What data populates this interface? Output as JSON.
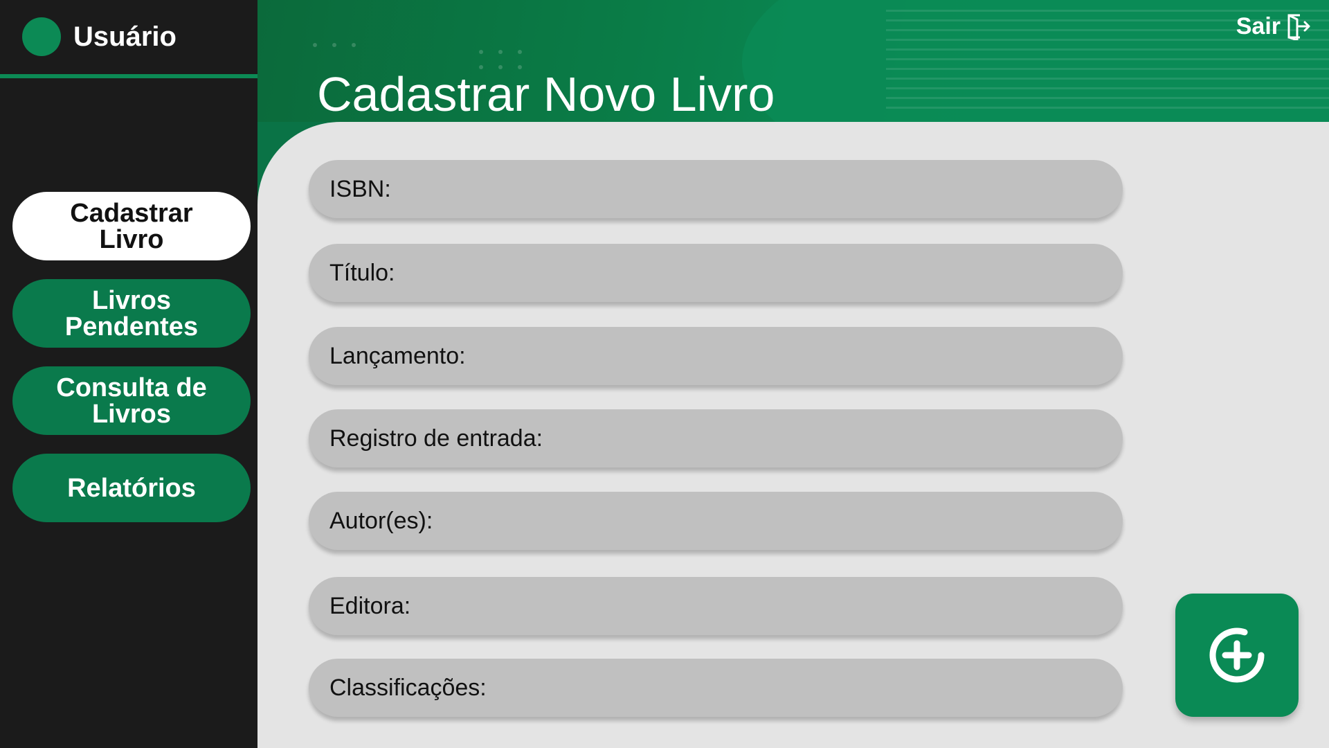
{
  "user": {
    "name": "Usuário"
  },
  "nav": {
    "items": [
      {
        "label": "Cadastrar Livro",
        "active": true
      },
      {
        "label": "Livros Pendentes",
        "active": false
      },
      {
        "label": "Consulta de Livros",
        "active": false
      },
      {
        "label": "Relatórios",
        "active": false
      }
    ]
  },
  "header": {
    "title": "Cadastrar Novo Livro",
    "logout_label": "Sair"
  },
  "form": {
    "fields": [
      {
        "label": "ISBN:",
        "value": ""
      },
      {
        "label": "Título:",
        "value": ""
      },
      {
        "label": "Lançamento:",
        "value": ""
      },
      {
        "label": "Registro de entrada:",
        "value": ""
      },
      {
        "label": "Autor(es):",
        "value": ""
      },
      {
        "label": "Editora:",
        "value": ""
      },
      {
        "label": "Classificações:",
        "value": ""
      }
    ]
  },
  "actions": {
    "add_icon": "add-circle-icon"
  },
  "colors": {
    "brand_green": "#0a7a4c",
    "sidebar_bg": "#1b1b1b",
    "content_bg": "#e4e4e4",
    "field_bg": "#c0c0c0"
  }
}
